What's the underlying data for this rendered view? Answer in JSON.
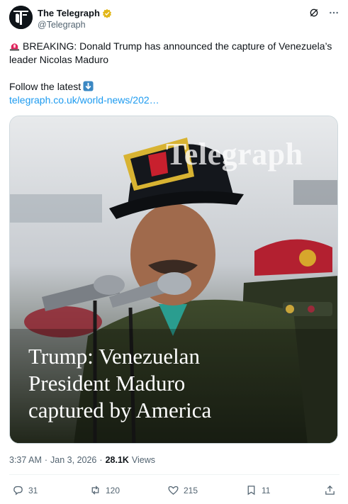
{
  "account": {
    "display_name": "The Telegraph",
    "handle": "@Telegraph"
  },
  "tweet": {
    "line1": "BREAKING: Donald Trump has announced the capture of Venezuela’s leader Nicolas Maduro",
    "line2": "Follow the latest",
    "link": "telegraph.co.uk/world-news/202…"
  },
  "media": {
    "watermark": "Telegraph",
    "headline_lines": [
      "Trump: Venezuelan",
      "President Maduro",
      "captured by America"
    ]
  },
  "meta": {
    "time": "3:37 AM",
    "separator": "·",
    "date": "Jan 3, 2026",
    "views_count": "28.1K",
    "views_label": "Views"
  },
  "actions": {
    "replies": "31",
    "reposts": "120",
    "likes": "215",
    "bookmarks": "11"
  },
  "colors": {
    "link": "#1d9bf0",
    "secondary_text": "#536471",
    "verified_badge": "#e2b719"
  },
  "icons": [
    "telegraph-logo",
    "verified-badge-icon",
    "grok-icon",
    "more-icon",
    "siren-emoji-icon",
    "down-arrow-emoji-icon",
    "reply-icon",
    "repost-icon",
    "like-icon",
    "bookmark-icon",
    "share-icon"
  ]
}
